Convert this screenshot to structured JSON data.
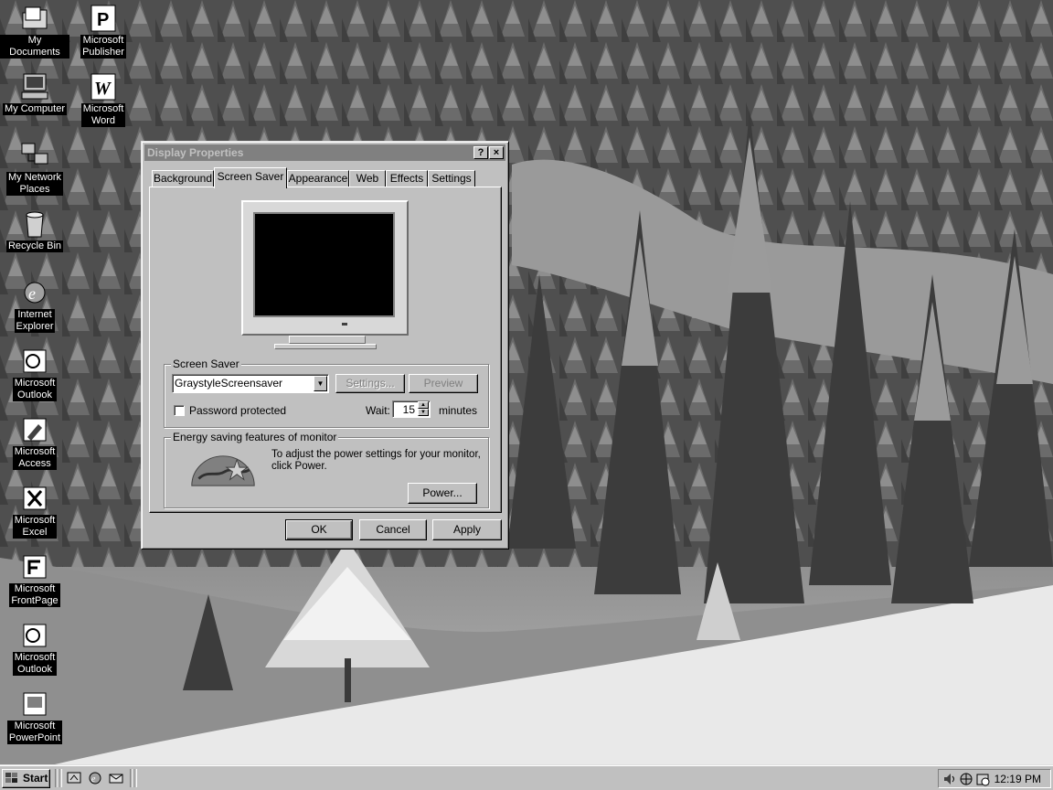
{
  "desktop": {
    "icons": [
      {
        "label": "My Documents",
        "icon": "folder-documents-icon"
      },
      {
        "label": "Microsoft\nPublisher",
        "icon": "publisher-icon"
      },
      {
        "label": "My Computer",
        "icon": "computer-icon"
      },
      {
        "label": "Microsoft\nWord",
        "icon": "word-icon"
      },
      {
        "label": "My Network\nPlaces",
        "icon": "network-places-icon"
      },
      {
        "label": "Recycle Bin",
        "icon": "recycle-bin-icon"
      },
      {
        "label": "Internet\nExplorer",
        "icon": "internet-explorer-icon"
      },
      {
        "label": "Microsoft\nOutlook",
        "icon": "outlook-icon"
      },
      {
        "label": "Microsoft\nAccess",
        "icon": "access-icon"
      },
      {
        "label": "Microsoft\nExcel",
        "icon": "excel-icon"
      },
      {
        "label": "Microsoft\nFrontPage",
        "icon": "frontpage-icon"
      },
      {
        "label": "Microsoft\nOutlook",
        "icon": "outlook-icon"
      },
      {
        "label": "Microsoft\nPowerPoint",
        "icon": "powerpoint-icon"
      }
    ]
  },
  "dialog": {
    "title": "Display Properties",
    "help_glyph": "?",
    "close_glyph": "×",
    "tabs": [
      "Background",
      "Screen Saver",
      "Appearance",
      "Web",
      "Effects",
      "Settings"
    ],
    "active_tab": "Screen Saver",
    "screen_saver": {
      "group_label": "Screen Saver",
      "selected": "GraystyleScreensaver",
      "settings_label": "Settings...",
      "preview_label": "Preview",
      "password_label": "Password protected",
      "password_checked": false,
      "wait_label": "Wait:",
      "wait_value": "15",
      "minutes_label": "minutes"
    },
    "energy": {
      "group_label": "Energy saving features of monitor",
      "text": "To adjust the power settings for your monitor, click Power.",
      "power_label": "Power..."
    },
    "buttons": {
      "ok": "OK",
      "cancel": "Cancel",
      "apply": "Apply"
    }
  },
  "taskbar": {
    "start_label": "Start",
    "quick_launch": [
      "show-desktop-icon",
      "internet-explorer-icon",
      "outlook-express-icon"
    ],
    "tray_icons": [
      "volume-icon",
      "network-icon",
      "scheduler-icon"
    ],
    "clock": "12:19 PM"
  }
}
